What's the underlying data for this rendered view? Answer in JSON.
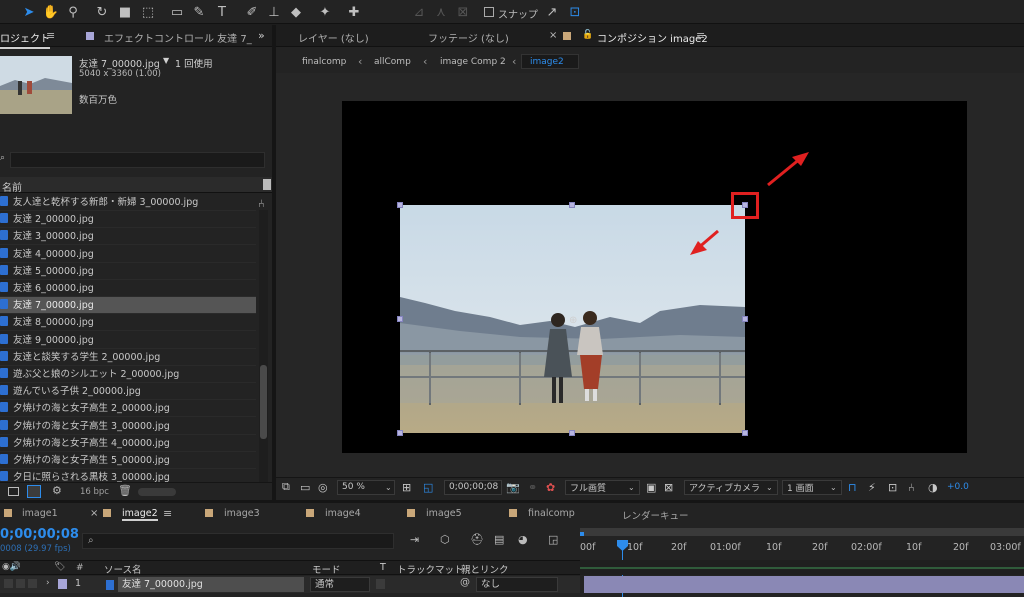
{
  "toolbar": {
    "snap_label": "スナップ"
  },
  "project_panel": {
    "tab_label": "ロジェクト",
    "effects_tab_label": "エフェクトコントロール 友達 7_",
    "preview": {
      "name": "友達 7_00000.jpg",
      "usage": "1 回使用",
      "dims": "5040 x 3360 (1.00)",
      "color": "数百万色"
    },
    "column_name": "名前",
    "items": [
      "友人達と乾杯する新郎・新婦 3_00000.jpg",
      "友達 2_00000.jpg",
      "友達 3_00000.jpg",
      "友達 4_00000.jpg",
      "友達 5_00000.jpg",
      "友達 6_00000.jpg",
      "友達 7_00000.jpg",
      "友達 8_00000.jpg",
      "友達 9_00000.jpg",
      "友達と談笑する学生 2_00000.jpg",
      "遊ぶ父と娘のシルエット 2_00000.jpg",
      "遊んでいる子供 2_00000.jpg",
      "夕焼けの海と女子高生 2_00000.jpg",
      "夕焼けの海と女子高生 3_00000.jpg",
      "夕焼けの海と女子高生 4_00000.jpg",
      "夕焼けの海と女子高生 5_00000.jpg",
      "夕日に照らされる黒枝 3_00000.jpg"
    ],
    "bpc": "16 bpc"
  },
  "viewer": {
    "tabs": {
      "layer": "レイヤー (なし)",
      "footage": "フッテージ (なし)",
      "composition": "コンポジション image2"
    },
    "breadcrumbs": [
      "finalcomp",
      "allComp",
      "image Comp 2",
      "image2"
    ],
    "zoom": "50 %",
    "timecode": "0;00;00;08",
    "quality": "フル画質",
    "camera": "アクティブカメラ",
    "view": "1 画面",
    "exposure": "+0.0"
  },
  "timeline": {
    "tabs": [
      "image1",
      "image2",
      "image3",
      "image4",
      "image5",
      "finalcomp",
      "レンダーキュー"
    ],
    "timecode": "0;00;00;08",
    "fps": "0008 (29.97 fps)",
    "search_placeholder": "",
    "columns": {
      "source": "ソース名",
      "mode": "モード",
      "t": "T",
      "trackmatte": "トラックマット",
      "parent": "親とリンク"
    },
    "layer": {
      "num": "1",
      "name": "友達 7_00000.jpg",
      "mode": "通常",
      "parent": "なし"
    },
    "ruler": [
      "00f",
      "10f",
      "20f",
      "01:00f",
      "10f",
      "20f",
      "02:00f",
      "10f",
      "20f",
      "03:00f"
    ]
  },
  "colors": {
    "accent": "#2d8ceb",
    "annotation": "#e02020",
    "handle": "#b7b5e0"
  }
}
